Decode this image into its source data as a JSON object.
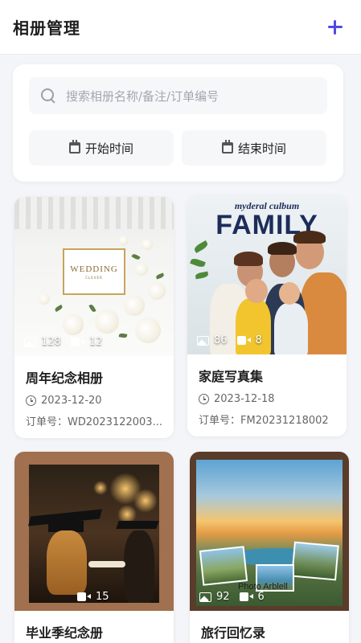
{
  "header": {
    "title": "相册管理",
    "add_icon": "plus-icon"
  },
  "search": {
    "placeholder": "搜索相册名称/备注/订单编号",
    "start_label": "开始时间",
    "end_label": "结束时间"
  },
  "albums": [
    {
      "name": "周年纪念相册",
      "date": "2023-12-20",
      "order": "订单号：WD2023122003...",
      "photos": "128",
      "videos": "12",
      "cover_title": "WEDDING",
      "cover_sub": "CLEVER"
    },
    {
      "name": "家庭写真集",
      "date": "2023-12-18",
      "order": "订单号：FM20231218002",
      "photos": "86",
      "videos": "8",
      "cover_brand": "myderal culbum",
      "cover_title": "FAMILY"
    },
    {
      "name": "毕业季纪念册",
      "videos": "15"
    },
    {
      "name": "旅行回忆录",
      "photos": "92",
      "videos": "6",
      "cover_caption": "Photo Arblell"
    }
  ],
  "colors": {
    "accent": "#4d4ce0",
    "background": "#f4f5f8"
  }
}
